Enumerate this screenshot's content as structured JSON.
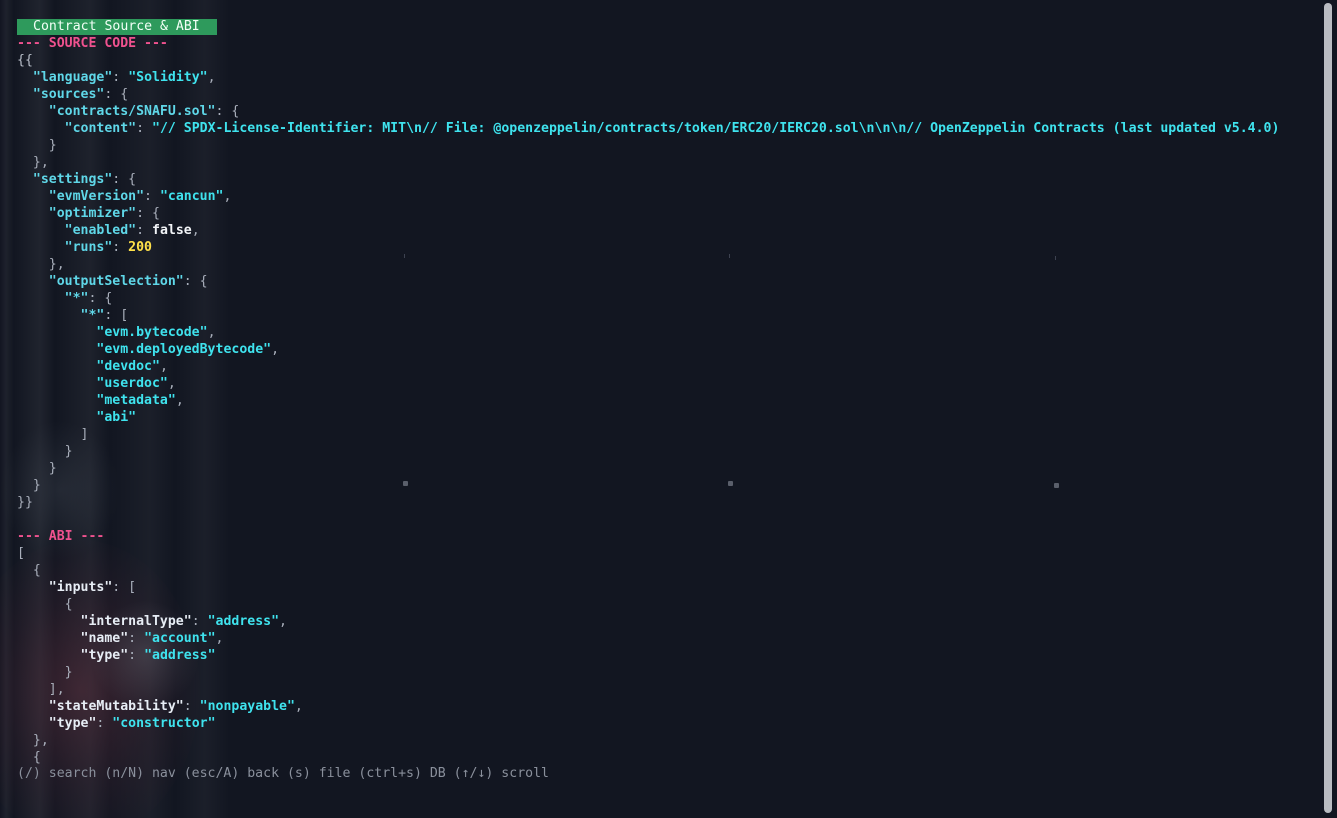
{
  "window": {
    "title": "Contract Source & ABI"
  },
  "sections": {
    "source_header": "--- SOURCE CODE ---",
    "abi_header": "--- ABI ---"
  },
  "source": {
    "open": "{{",
    "close": "}}",
    "language_key": "\"language\"",
    "language_val": "\"Solidity\"",
    "sources_key": "\"sources\"",
    "file_key": "\"contracts/SNAFU.sol\"",
    "content_key": "\"content\"",
    "content_val": "\"// SPDX-License-Identifier: MIT\\n// File: @openzeppelin/contracts/token/ERC20/IERC20.sol\\n\\n\\n// OpenZeppelin Contracts (last updated v5.4.0)",
    "settings_key": "\"settings\"",
    "evm_key": "\"evmVersion\"",
    "evm_val": "\"cancun\"",
    "optimizer_key": "\"optimizer\"",
    "enabled_key": "\"enabled\"",
    "enabled_val": "false",
    "runs_key": "\"runs\"",
    "runs_val": "200",
    "output_key": "\"outputSelection\"",
    "star_key": "\"*\"",
    "outputs": [
      "\"evm.bytecode\"",
      "\"evm.deployedBytecode\"",
      "\"devdoc\"",
      "\"userdoc\"",
      "\"metadata\"",
      "\"abi\""
    ]
  },
  "abi": {
    "open": "[",
    "inputs_key": "\"inputs\"",
    "internal_key": "\"internalType\"",
    "internal_val": "\"address\"",
    "name_key": "\"name\"",
    "name_val": "\"account\"",
    "type_key": "\"type\"",
    "type_val": "\"address\"",
    "mut_key": "\"stateMutability\"",
    "mut_val": "\"nonpayable\"",
    "ctype_key": "\"type\"",
    "ctype_val": "\"constructor\""
  },
  "footer": {
    "help": "(/) search (n/N) nav (esc/A) back (s) file (ctrl+s) DB (↑/↓) scroll"
  }
}
